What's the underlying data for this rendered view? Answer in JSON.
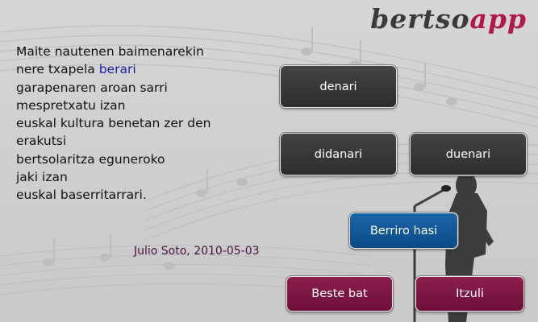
{
  "logo": {
    "part1": "bertso",
    "part2": "app"
  },
  "verse": {
    "lines": [
      {
        "before": "Maite nautenen baimenarekin",
        "highlight": "",
        "after": ""
      },
      {
        "before": "nere txapela ",
        "highlight": "berari",
        "after": ""
      },
      {
        "before": "garapenaren aroan sarri",
        "highlight": "",
        "after": ""
      },
      {
        "before": "mespretxatu izan",
        "highlight": "",
        "after": ""
      },
      {
        "before": "euskal kultura benetan zer den",
        "highlight": "",
        "after": ""
      },
      {
        "before": "erakutsi",
        "highlight": "",
        "after": ""
      },
      {
        "before": "bertsolaritza eguneroko",
        "highlight": "",
        "after": ""
      },
      {
        "before": "jaki izan",
        "highlight": "",
        "after": ""
      },
      {
        "before": "euskal baserritarrari.",
        "highlight": "",
        "after": ""
      }
    ],
    "signature": "Julio Soto, 2010-05-03"
  },
  "answers": {
    "a": "denari",
    "b": "didanari",
    "c": "duenari"
  },
  "buttons": {
    "restart": "Berriro hasi",
    "another": "Beste bat",
    "back": "Itzuli"
  },
  "colors": {
    "logo_dark": "#3a3a3a",
    "logo_accent": "#b0174a",
    "answer_bg": "#333333",
    "restart_bg": "#0d4f8e",
    "nav_bg": "#7c1544",
    "highlight": "#1a1a9e"
  },
  "icons": {
    "background": "music-staff-and-singer-silhouette"
  }
}
